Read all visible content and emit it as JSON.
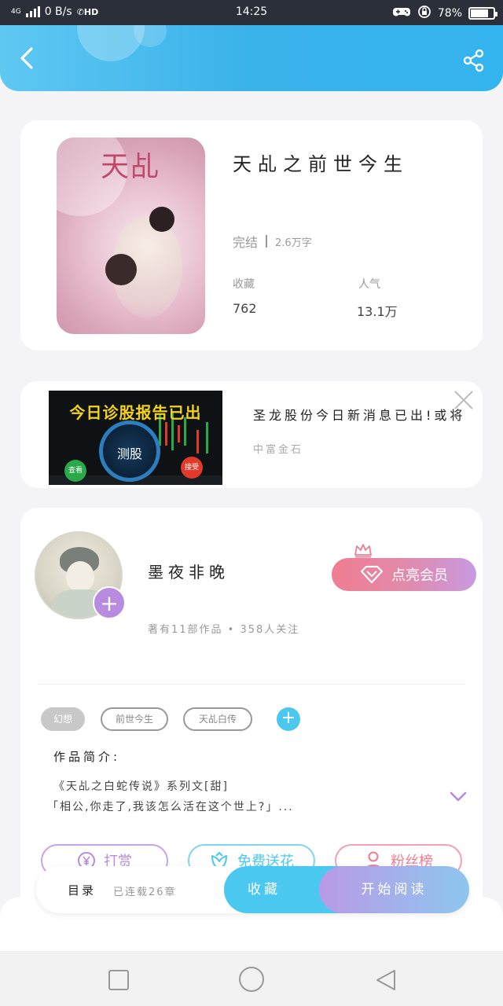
{
  "status_bar": {
    "network": "4G",
    "speed": "0 B/s",
    "hd": "HD",
    "time": "14:25",
    "battery": "78%",
    "battery_level": 0.78
  },
  "book": {
    "cover_title": "天乩",
    "title": "天乩之前世今生",
    "status": "完结",
    "word_count": "2.6万字",
    "favorites_label": "收藏",
    "favorites_value": "762",
    "popularity_label": "人气",
    "popularity_value": "13.1万"
  },
  "ad": {
    "image_headline": "今日诊股报告已出",
    "dial_text": "测股",
    "view_label": "查看",
    "accept_label": "接受",
    "text": "圣龙股份今日新消息已出!或将",
    "source": "中富金石"
  },
  "author": {
    "name": "墨夜非晚",
    "meta": "著有11部作品 • 358人关注",
    "vip_label": "点亮会员"
  },
  "tags": [
    "幻想",
    "前世今生",
    "天乩白传"
  ],
  "intro": {
    "label": "作品简介:",
    "line1": "《天乩之白蛇传说》系列文[甜]",
    "line2": "「相公,你走了,我该怎么活在这个世上?」..."
  },
  "actions": {
    "tip": "打赏",
    "flower": "免费送花",
    "fans": "粉丝榜"
  },
  "bottom_bar": {
    "toc": "目录",
    "toc_meta": "已连载26章",
    "favorite": "收藏",
    "start_reading": "开始阅读"
  },
  "colors": {
    "header_blue": "#3ab2ea",
    "accent_cyan": "#4ac8f0",
    "vip_pink": "#ef7d92",
    "purple": "#b78be0",
    "tip_color": "#b78be0",
    "flower_color": "#4ac8f0",
    "fans_color": "#ef7d92"
  }
}
